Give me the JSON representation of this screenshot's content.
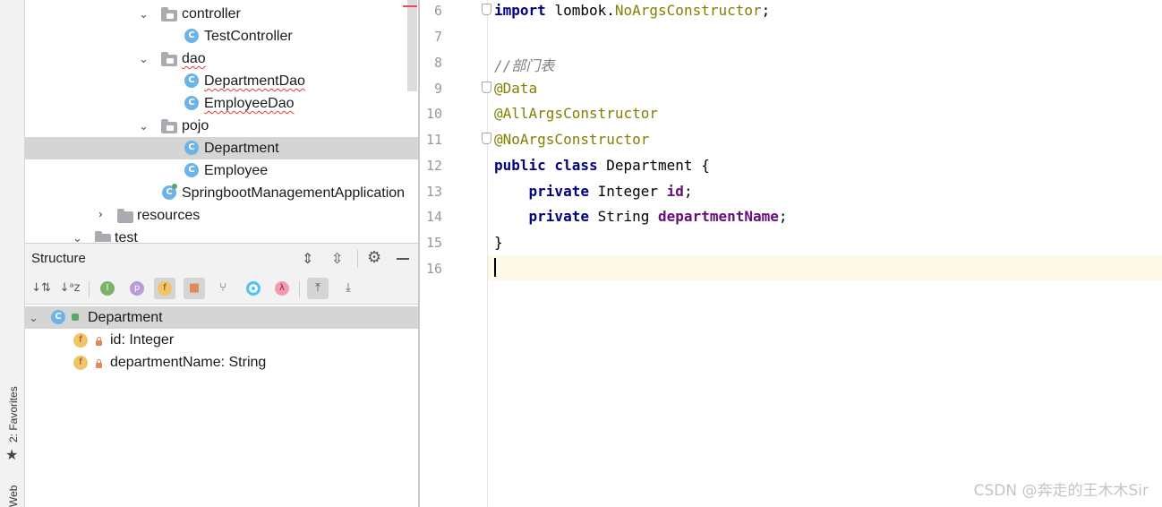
{
  "side_strip": {
    "favorites": "2: Favorites",
    "web": "Web"
  },
  "project_tree": {
    "items": [
      {
        "label": "controller",
        "kind": "package"
      },
      {
        "label": "TestController",
        "kind": "class"
      },
      {
        "label": "dao",
        "kind": "package"
      },
      {
        "label": "DepartmentDao",
        "kind": "class"
      },
      {
        "label": "EmployeeDao",
        "kind": "class"
      },
      {
        "label": "pojo",
        "kind": "package"
      },
      {
        "label": "Department",
        "kind": "class",
        "selected": true
      },
      {
        "label": "Employee",
        "kind": "class"
      },
      {
        "label": "SpringbootManagementApplication",
        "kind": "app-class"
      },
      {
        "label": "resources",
        "kind": "folder"
      },
      {
        "label": "test",
        "kind": "folder"
      }
    ]
  },
  "structure": {
    "title": "Structure",
    "root": "Department",
    "fields": [
      {
        "label": "id: Integer"
      },
      {
        "label": "departmentName: String"
      }
    ],
    "filter_letters": {
      "inherited": "I",
      "property": "p",
      "field": "f",
      "lambda": "λ"
    }
  },
  "editor": {
    "lines": [
      {
        "n": "6",
        "text": "import lombok.NoArgsConstructor;"
      },
      {
        "n": "7",
        "text": ""
      },
      {
        "n": "8",
        "text": "//部门表"
      },
      {
        "n": "9",
        "text": "@Data"
      },
      {
        "n": "10",
        "text": "@AllArgsConstructor"
      },
      {
        "n": "11",
        "text": "@NoArgsConstructor"
      },
      {
        "n": "12",
        "text": "public class Department {"
      },
      {
        "n": "13",
        "text": "    private Integer id;"
      },
      {
        "n": "14",
        "text": "    private String departmentName;"
      },
      {
        "n": "15",
        "text": "}"
      },
      {
        "n": "16",
        "text": ""
      }
    ],
    "tokens": {
      "import_kw": "import",
      "import_pkg": "lombok.",
      "import_cls": "NoArgsConstructor",
      "semi": ";",
      "comment": "//部门表",
      "ann1": "@Data",
      "ann2": "@AllArgsConstructor",
      "ann3": "@NoArgsConstructor",
      "public_class": "public class",
      "class_name": " Department {",
      "private": "private",
      "type1": " Integer ",
      "field1": "id",
      "type2": " String ",
      "field2": "departmentName",
      "close": "}"
    }
  },
  "watermark": "CSDN @奔走的王木木Sir",
  "colors": {
    "keyword": "#000080",
    "annotation": "#808000",
    "comment": "#808080",
    "field": "#660e7a",
    "class_icon": "#6bb3e8"
  }
}
